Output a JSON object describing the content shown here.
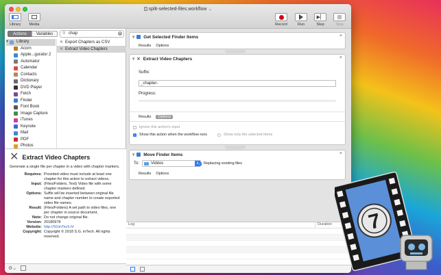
{
  "window": {
    "title": "split-selected-files.workflow",
    "title_suffix": "⌄"
  },
  "toolbar": {
    "library_label": "Library",
    "media_label": "Media",
    "record_label": "Record",
    "run_label": "Run",
    "step_label": "Step",
    "stop_label": "Stop"
  },
  "left": {
    "actions_tab": "Actions",
    "variables_tab": "Variables",
    "search_value": "chap",
    "library_header": "Library",
    "library_items": [
      "Acorn",
      "Apple...gurator 2",
      "Automator",
      "Calendar",
      "Contacts",
      "Dictionary",
      "DVD Player",
      "Fetch",
      "Finder",
      "Font Book",
      "Image Capture",
      "iTunes",
      "Keynote",
      "Mail",
      "PDF",
      "Photos"
    ],
    "library_colors": [
      "#c0782a",
      "#3a8ad6",
      "#7a7a7a",
      "#e04a3a",
      "#b08a5a",
      "#6a6a6a",
      "#333333",
      "#7a4a9a",
      "#3a7ad8",
      "#555555",
      "#4a8a4a",
      "#d03aa0",
      "#3a6ad0",
      "#3a8ad8",
      "#c03030",
      "#e0a020"
    ],
    "action_results": [
      "Export Chapters as CSV",
      "Extract Video Chapters"
    ]
  },
  "description": {
    "title": "Extract Video Chapters",
    "summary": "Generate a single file per chapter in a video with chapter markers.",
    "fields": [
      {
        "key": "Requires:",
        "value": "Provided video must include at least one chapter for this action to extract videos."
      },
      {
        "key": "Input:",
        "value": "(Files/Folders, Text) Video file with some chapter markers defined."
      },
      {
        "key": "Options:",
        "value": "Suffix will be inserted between original file name and chapter number to create exported video file names."
      },
      {
        "key": "Result:",
        "value": "(Files/Folders) A set path to video files, one per chapter in source document."
      },
      {
        "key": "Note:",
        "value": "Do not change original file."
      },
      {
        "key": "Version:",
        "value": "20180978"
      },
      {
        "key": "Website:",
        "value": "http://SGinTech.fr/"
      },
      {
        "key": "Copyright:",
        "value": "Copyright © 2018 S.G. inTech. All rights reserved."
      }
    ]
  },
  "workflow": {
    "card1": {
      "title": "Get Selected Finder Items",
      "results": "Results",
      "options": "Options"
    },
    "card2": {
      "title": "Extract Video Chapters",
      "suffix_label": "Suffix:",
      "suffix_value": "_chapter-",
      "progress_label": "Progress:",
      "progress_value": 0,
      "results": "Results",
      "options": "Options",
      "ignore_input": "Ignore this action's input",
      "show_when_runs": "Show this action when the workflow runs",
      "show_selected_only": "Show only the selected items"
    },
    "card3": {
      "title": "Move Finder Items",
      "to_label": "To:",
      "to_value": "Vidéos",
      "replacing_label": "Replacing existing files",
      "results": "Results",
      "options": "Options"
    }
  },
  "log": {
    "log_header": "Log",
    "duration_header": "Duration"
  },
  "colors": {
    "record": "#d0021b",
    "selected_row": "#d4d4d4",
    "accent": "#2e7bf6"
  }
}
